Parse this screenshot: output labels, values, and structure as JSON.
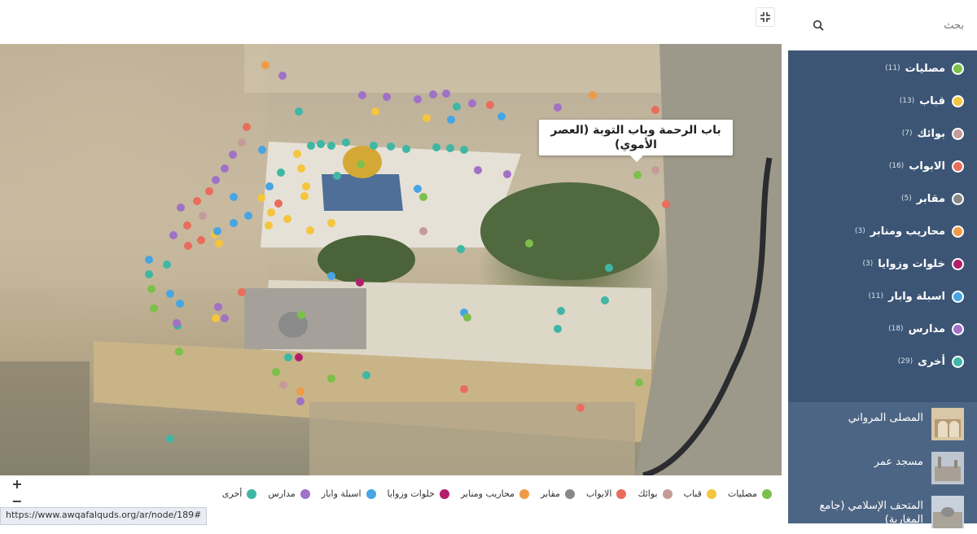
{
  "map": {
    "tooltip_text": "باب الرحمة وباب التوبة (العصر الأموي)",
    "zoom_in_label": "+",
    "zoom_out_label": "−",
    "status_url": "https://www.awqafalquds.org/ar/node/189#"
  },
  "legend": [
    {
      "label": "مصليات",
      "color": "#7cc04b"
    },
    {
      "label": "قباب",
      "color": "#f4c53d"
    },
    {
      "label": "بوائك",
      "color": "#c59b9a"
    },
    {
      "label": "الابواب",
      "color": "#e96d5c"
    },
    {
      "label": "مقابر",
      "color": "#888888"
    },
    {
      "label": "محاريب ومنابر",
      "color": "#f09a45"
    },
    {
      "label": "خلوات وزوايا",
      "color": "#b31e6b"
    },
    {
      "label": "اسبلة وابار",
      "color": "#48a5e3"
    },
    {
      "label": "مدارس",
      "color": "#a071c6"
    },
    {
      "label": "أخرى",
      "color": "#3fb7a4"
    }
  ],
  "sidebar": {
    "search_placeholder": "بحث",
    "categories": [
      {
        "label": "مصليات",
        "count": "(11)",
        "color": "#7cc04b"
      },
      {
        "label": "قباب",
        "count": "(13)",
        "color": "#f4c53d"
      },
      {
        "label": "بوائك",
        "count": "(7)",
        "color": "#c59b9a"
      },
      {
        "label": "الابواب",
        "count": "(16)",
        "color": "#e96d5c"
      },
      {
        "label": "مقابر",
        "count": "(5)",
        "color": "#888888"
      },
      {
        "label": "محاريب ومنابر",
        "count": "(3)",
        "color": "#f09a45"
      },
      {
        "label": "خلوات وزوايا",
        "count": "(3)",
        "color": "#b31e6b"
      },
      {
        "label": "اسبلة وابار",
        "count": "(11)",
        "color": "#48a5e3"
      },
      {
        "label": "مدارس",
        "count": "(18)",
        "color": "#a071c6"
      },
      {
        "label": "أخرى",
        "count": "(29)",
        "color": "#3fb7a4"
      }
    ],
    "places": [
      {
        "title": "المصلى المرواني"
      },
      {
        "title": "مسجد عمر"
      },
      {
        "title": "المتحف الإسلامي (جامع المغاربة)"
      }
    ]
  }
}
